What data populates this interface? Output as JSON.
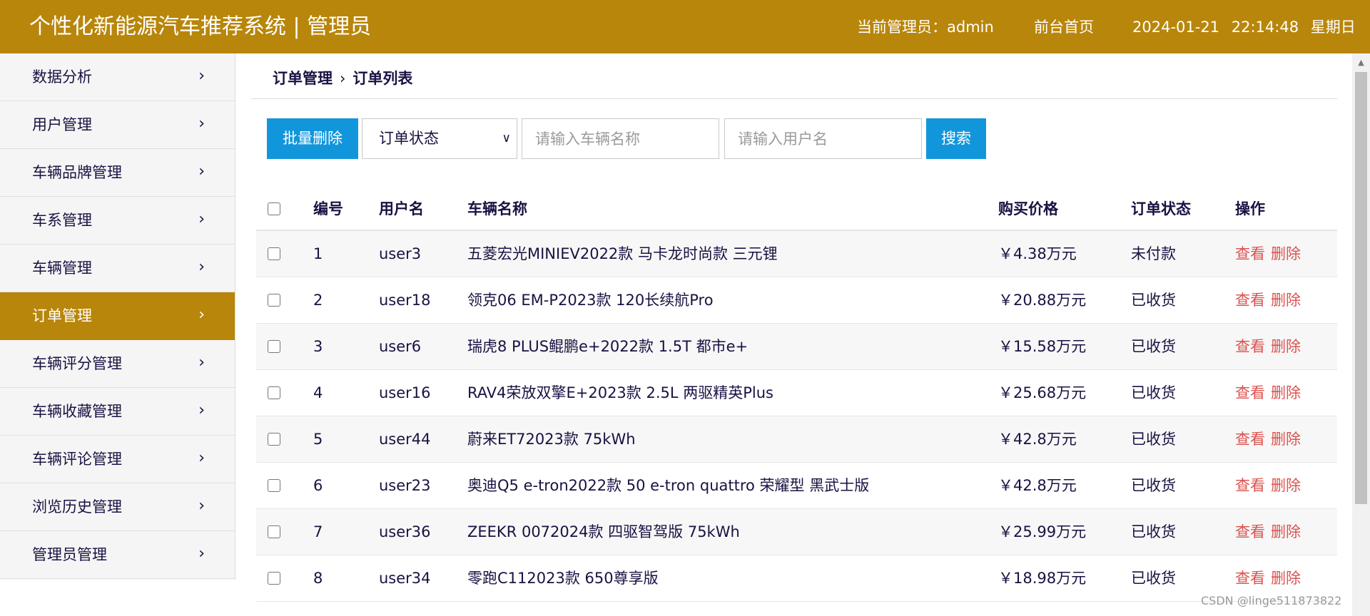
{
  "header": {
    "title": "个性化新能源汽车推荐系统 | 管理员",
    "admin_label": "当前管理员：admin",
    "home_link": "前台首页",
    "date": "2024-01-21",
    "time": "22:14:48",
    "weekday": "星期日",
    "bg_color": "#b8860b"
  },
  "sidebar": {
    "items": [
      {
        "label": "数据分析"
      },
      {
        "label": "用户管理"
      },
      {
        "label": "车辆品牌管理"
      },
      {
        "label": "车系管理"
      },
      {
        "label": "车辆管理"
      },
      {
        "label": "订单管理",
        "active": true
      },
      {
        "label": "车辆评分管理"
      },
      {
        "label": "车辆收藏管理"
      },
      {
        "label": "车辆评论管理"
      },
      {
        "label": "浏览历史管理"
      },
      {
        "label": "管理员管理"
      }
    ],
    "chevron_icon": "chevron-right-icon"
  },
  "breadcrumb": {
    "parent": "订单管理",
    "separator": "›",
    "current": "订单列表"
  },
  "toolbar": {
    "batch_delete": "批量删除",
    "status_select": "订单状态",
    "car_placeholder": "请输入车辆名称",
    "user_placeholder": "请输入用户名",
    "search": "搜索",
    "button_color": "#1296db"
  },
  "table": {
    "headers": {
      "id": "编号",
      "user": "用户名",
      "car": "车辆名称",
      "price": "购买价格",
      "status": "订单状态",
      "op": "操作"
    },
    "actions": {
      "view": "查看",
      "delete": "删除"
    },
    "rows": [
      {
        "id": "1",
        "user": "user3",
        "car": "五菱宏光MINIEV2022款 马卡龙时尚款 三元锂",
        "price": "￥4.38万元",
        "status": "未付款"
      },
      {
        "id": "2",
        "user": "user18",
        "car": "领克06 EM-P2023款 120长续航Pro",
        "price": "￥20.88万元",
        "status": "已收货"
      },
      {
        "id": "3",
        "user": "user6",
        "car": "瑞虎8 PLUS鲲鹏e+2022款 1.5T 都市e+",
        "price": "￥15.58万元",
        "status": "已收货"
      },
      {
        "id": "4",
        "user": "user16",
        "car": "RAV4荣放双擎E+2023款 2.5L 两驱精英Plus",
        "price": "￥25.68万元",
        "status": "已收货"
      },
      {
        "id": "5",
        "user": "user44",
        "car": "蔚来ET72023款 75kWh",
        "price": "￥42.8万元",
        "status": "已收货"
      },
      {
        "id": "6",
        "user": "user23",
        "car": "奥迪Q5 e-tron2022款 50 e-tron quattro 荣耀型 黑武士版",
        "price": "￥42.8万元",
        "status": "已收货"
      },
      {
        "id": "7",
        "user": "user36",
        "car": "ZEEKR 0072024款 四驱智驾版 75kWh",
        "price": "￥25.99万元",
        "status": "已收货"
      },
      {
        "id": "8",
        "user": "user34",
        "car": "零跑C112023款 650尊享版",
        "price": "￥18.98万元",
        "status": "已收货"
      }
    ],
    "action_color": "#d9534f"
  },
  "watermark": "CSDN @linge511873822"
}
